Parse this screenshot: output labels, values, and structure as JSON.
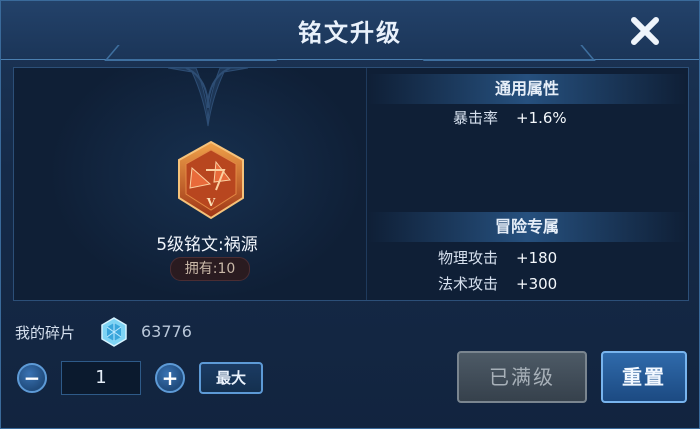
{
  "dialog": {
    "title": "铭文升级",
    "close_icon": "close-icon"
  },
  "rune": {
    "name": "5级铭文:祸源",
    "owned": "拥有:10",
    "emblem_icon": "rune-emblem-icon",
    "emblem_numeral": "V"
  },
  "stats": {
    "general": {
      "header": "通用属性",
      "rows": [
        {
          "label": "暴击率",
          "value": "+1.6%"
        }
      ]
    },
    "adventure": {
      "header": "冒险专属",
      "rows": [
        {
          "label": "物理攻击",
          "value": "+180"
        },
        {
          "label": "法术攻击",
          "value": "+300"
        }
      ]
    }
  },
  "shards": {
    "label": "我的碎片",
    "count": "63776",
    "icon": "crystal-shard-icon"
  },
  "quantity": {
    "value": "1",
    "minus_icon": "minus-icon",
    "plus_icon": "plus-icon",
    "max_label": "最大"
  },
  "actions": {
    "maxed_label": "已满级",
    "reset_label": "重置"
  },
  "colors": {
    "panel_bg": "#152a48",
    "accent_blue": "#5d9ad6",
    "emblem_orange": "#d8602a",
    "disabled_gray": "#4d5a66"
  }
}
